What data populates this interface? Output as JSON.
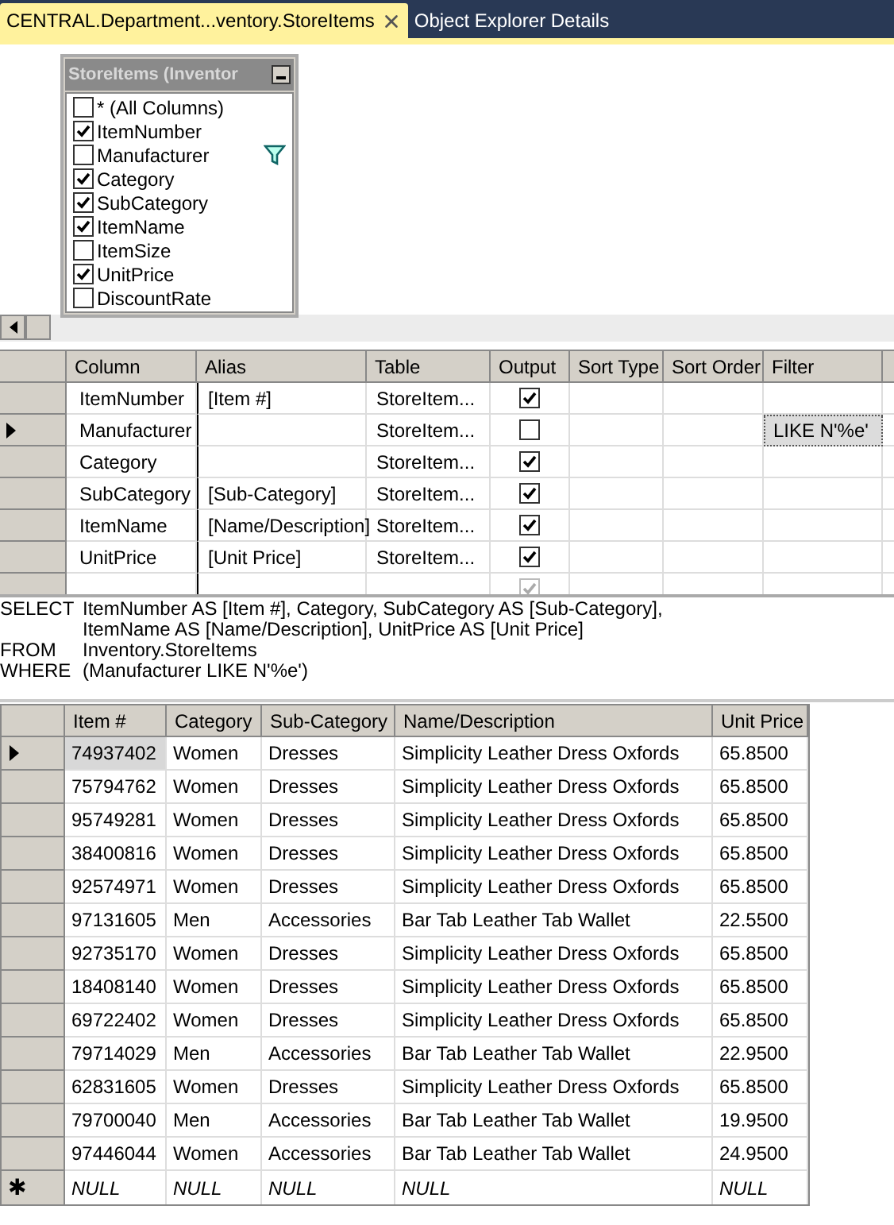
{
  "tabs": [
    {
      "label": "CENTRAL.Department...ventory.StoreItems",
      "selected": true,
      "closable": true
    },
    {
      "label": "Object Explorer Details",
      "selected": false,
      "closable": false
    }
  ],
  "diagram": {
    "table": {
      "title": "StoreItems (Inventor",
      "items": [
        {
          "label": "* (All Columns)",
          "checked": false,
          "filtered": false
        },
        {
          "label": "ItemNumber",
          "checked": true,
          "filtered": false
        },
        {
          "label": "Manufacturer",
          "checked": false,
          "filtered": true
        },
        {
          "label": "Category",
          "checked": true,
          "filtered": false
        },
        {
          "label": "SubCategory",
          "checked": true,
          "filtered": false
        },
        {
          "label": "ItemName",
          "checked": true,
          "filtered": false
        },
        {
          "label": "ItemSize",
          "checked": false,
          "filtered": false
        },
        {
          "label": "UnitPrice",
          "checked": true,
          "filtered": false
        },
        {
          "label": "DiscountRate",
          "checked": false,
          "filtered": false
        }
      ]
    }
  },
  "criteria": {
    "columns": [
      "Column",
      "Alias",
      "Table",
      "Output",
      "Sort Type",
      "Sort Order",
      "Filter"
    ],
    "rows": [
      {
        "column": "ItemNumber",
        "alias": "[Item #]",
        "table": "StoreItem...",
        "output": true,
        "selected": false
      },
      {
        "column": "Manufacturer",
        "table": "StoreItem...",
        "output": false,
        "filter": "LIKE N'%e'",
        "selected": true
      },
      {
        "column": "Category",
        "table": "StoreItem...",
        "output": true,
        "selected": false
      },
      {
        "column": "SubCategory",
        "alias": "[Sub-Category]",
        "table": "StoreItem...",
        "output": true,
        "selected": false
      },
      {
        "column": "ItemName",
        "alias": "[Name/Description]",
        "table": "StoreItem...",
        "output": true,
        "selected": false
      },
      {
        "column": "UnitPrice",
        "alias": "[Unit Price]",
        "table": "StoreItem...",
        "output": true,
        "selected": false
      },
      {
        "output": true,
        "selected": false,
        "disabled": true
      }
    ]
  },
  "sql": [
    {
      "keyword": "SELECT",
      "text": "ItemNumber AS [Item #], Category, SubCategory AS [Sub-Category],"
    },
    {
      "text": "ItemName AS [Name/Description], UnitPrice AS [Unit Price]"
    },
    {
      "keyword": "FROM",
      "text": "Inventory.StoreItems"
    },
    {
      "keyword": "WHERE",
      "text": "(Manufacturer LIKE N'%e')"
    }
  ],
  "results": {
    "columns": [
      "Item #",
      "Category",
      "Sub-Category",
      "Name/Description",
      "Unit Price"
    ],
    "rows": [
      {
        "cells": [
          "74937402",
          "Women",
          "Dresses",
          "Simplicity Leather Dress Oxfords",
          "65.8500"
        ],
        "selected": true
      },
      {
        "cells": [
          "75794762",
          "Women",
          "Dresses",
          "Simplicity Leather Dress Oxfords",
          "65.8500"
        ],
        "selected": false
      },
      {
        "cells": [
          "95749281",
          "Women",
          "Dresses",
          "Simplicity Leather Dress Oxfords",
          "65.8500"
        ],
        "selected": false
      },
      {
        "cells": [
          "38400816",
          "Women",
          "Dresses",
          "Simplicity Leather Dress Oxfords",
          "65.8500"
        ],
        "selected": false
      },
      {
        "cells": [
          "92574971",
          "Women",
          "Dresses",
          "Simplicity Leather Dress Oxfords",
          "65.8500"
        ],
        "selected": false
      },
      {
        "cells": [
          "97131605",
          "Men",
          "Accessories",
          "Bar Tab Leather Tab Wallet",
          "22.5500"
        ],
        "selected": false
      },
      {
        "cells": [
          "92735170",
          "Women",
          "Dresses",
          "Simplicity Leather Dress Oxfords",
          "65.8500"
        ],
        "selected": false
      },
      {
        "cells": [
          "18408140",
          "Women",
          "Dresses",
          "Simplicity Leather Dress Oxfords",
          "65.8500"
        ],
        "selected": false
      },
      {
        "cells": [
          "69722402",
          "Women",
          "Dresses",
          "Simplicity Leather Dress Oxfords",
          "65.8500"
        ],
        "selected": false
      },
      {
        "cells": [
          "79714029",
          "Men",
          "Accessories",
          "Bar Tab Leather Tab Wallet",
          "22.9500"
        ],
        "selected": false
      },
      {
        "cells": [
          "62831605",
          "Women",
          "Dresses",
          "Simplicity Leather Dress Oxfords",
          "65.8500"
        ],
        "selected": false
      },
      {
        "cells": [
          "79700040",
          "Men",
          "Accessories",
          "Bar Tab Leather Tab Wallet",
          "19.9500"
        ],
        "selected": false
      },
      {
        "cells": [
          "97446044",
          "Women",
          "Accessories",
          "Bar Tab Leather Tab Wallet",
          "24.9500"
        ],
        "selected": false
      }
    ],
    "new_row": {
      "marker": "✱",
      "cells": [
        "NULL",
        "NULL",
        "NULL",
        "NULL",
        "NULL"
      ]
    }
  }
}
